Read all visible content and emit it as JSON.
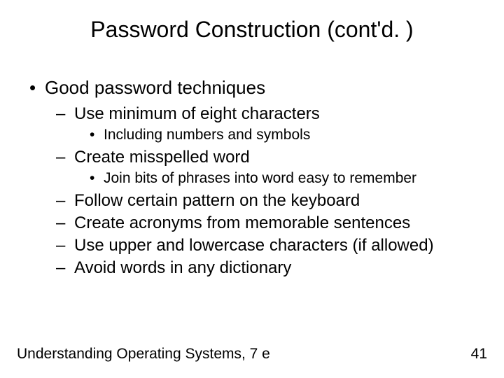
{
  "title": "Password Construction (cont'd. )",
  "bullets": {
    "l1": "Good password techniques",
    "l2a": "Use minimum of eight characters",
    "l3a": "Including numbers and symbols",
    "l2b": "Create misspelled word",
    "l3b": "Join bits of phrases into word easy to remember",
    "l2c": "Follow certain pattern on the keyboard",
    "l2d": "Create acronyms from memorable sentences",
    "l2e": "Use upper and lowercase characters (if allowed)",
    "l2f": "Avoid words in any dictionary"
  },
  "footer": {
    "left": "Understanding Operating Systems, 7 e",
    "right": "41"
  }
}
